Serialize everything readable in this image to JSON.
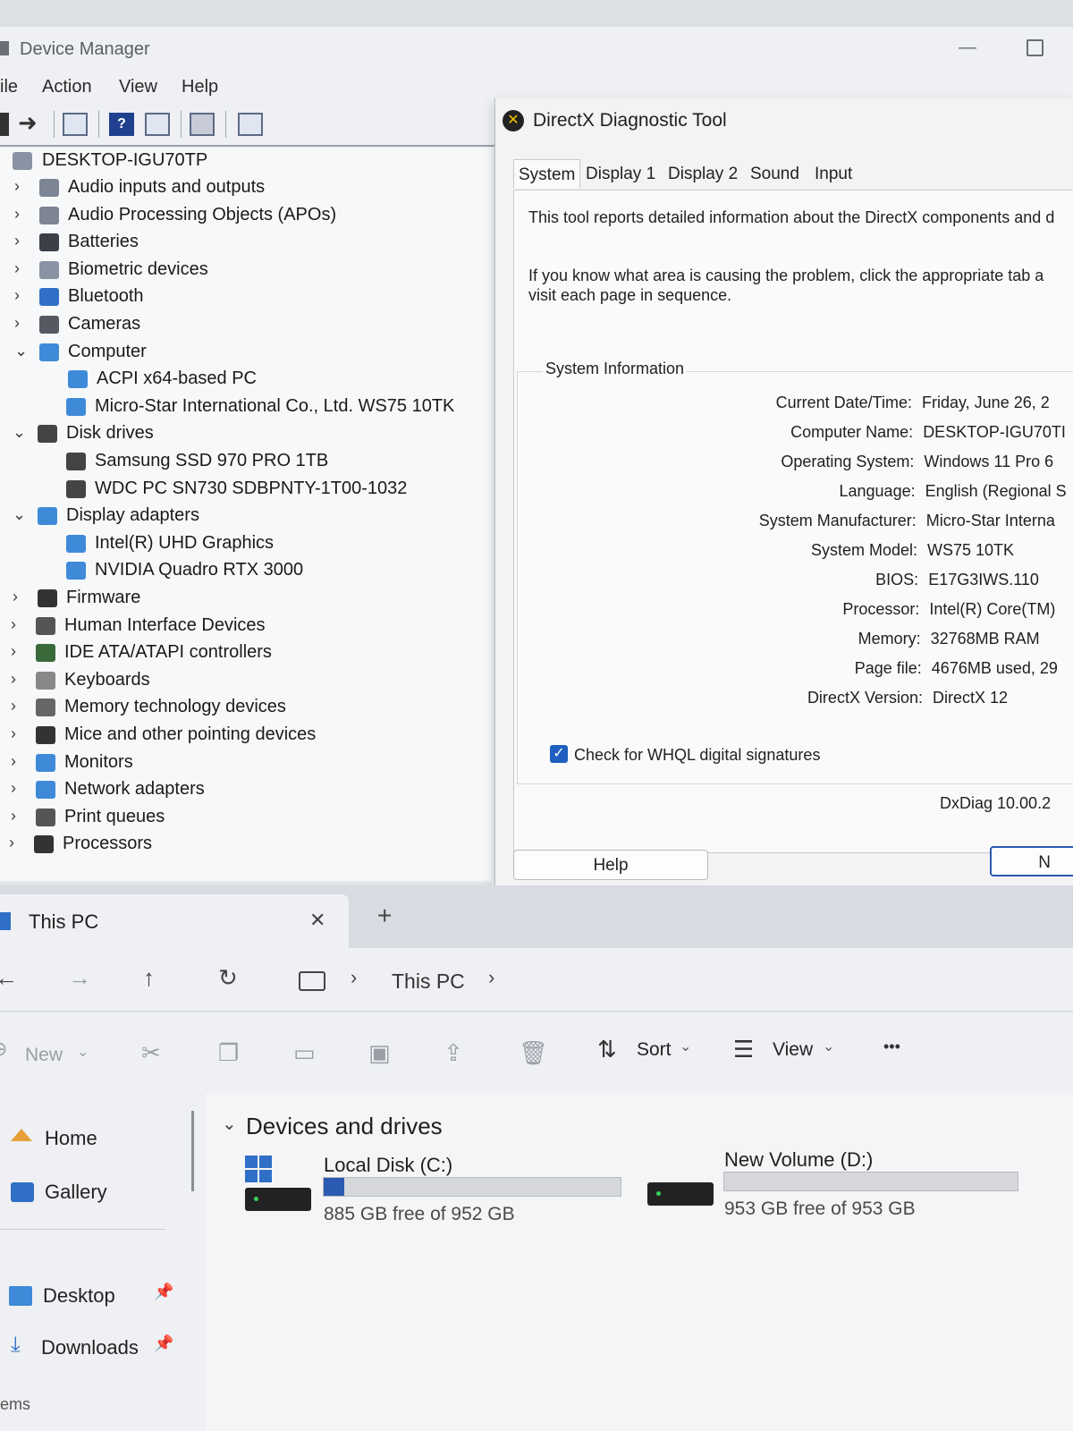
{
  "device_manager": {
    "title": "Device Manager",
    "menu": [
      "ile",
      "Action",
      "View",
      "Help"
    ],
    "computer_name": "DESKTOP-IGU70TP",
    "tree": [
      {
        "label": "Audio inputs and outputs",
        "expanded": false,
        "level": 1
      },
      {
        "label": "Audio Processing Objects (APOs)",
        "expanded": false,
        "level": 1
      },
      {
        "label": "Batteries",
        "expanded": false,
        "level": 1
      },
      {
        "label": "Biometric devices",
        "expanded": false,
        "level": 1
      },
      {
        "label": "Bluetooth",
        "expanded": false,
        "level": 1
      },
      {
        "label": "Cameras",
        "expanded": false,
        "level": 1
      },
      {
        "label": "Computer",
        "expanded": true,
        "level": 1
      },
      {
        "label": "ACPI x64-based PC",
        "level": 2
      },
      {
        "label": "Micro-Star International Co., Ltd. WS75 10TK",
        "level": 2
      },
      {
        "label": "Disk drives",
        "expanded": true,
        "level": 1
      },
      {
        "label": "Samsung SSD 970 PRO 1TB",
        "level": 2
      },
      {
        "label": "WDC PC SN730 SDBPNTY-1T00-1032",
        "level": 2
      },
      {
        "label": "Display adapters",
        "expanded": true,
        "level": 1
      },
      {
        "label": "Intel(R) UHD Graphics",
        "level": 2
      },
      {
        "label": "NVIDIA Quadro RTX 3000",
        "level": 2
      },
      {
        "label": "Firmware",
        "expanded": false,
        "level": 1
      },
      {
        "label": "Human Interface Devices",
        "expanded": false,
        "level": 1
      },
      {
        "label": "IDE ATA/ATAPI controllers",
        "expanded": false,
        "level": 1
      },
      {
        "label": "Keyboards",
        "expanded": false,
        "level": 1
      },
      {
        "label": "Memory technology devices",
        "expanded": false,
        "level": 1
      },
      {
        "label": "Mice and other pointing devices",
        "expanded": false,
        "level": 1
      },
      {
        "label": "Monitors",
        "expanded": false,
        "level": 1
      },
      {
        "label": "Network adapters",
        "expanded": false,
        "level": 1
      },
      {
        "label": "Print queues",
        "expanded": false,
        "level": 1
      },
      {
        "label": "Processors",
        "expanded": false,
        "level": 1
      }
    ]
  },
  "directx": {
    "title": "DirectX Diagnostic Tool",
    "tabs": [
      "System",
      "Display 1",
      "Display 2",
      "Sound",
      "Input"
    ],
    "intro1": "This tool reports detailed information about the DirectX components and d",
    "intro2": "If you know what area is causing the problem, click the appropriate tab a",
    "intro3": "visit each page in sequence.",
    "group_title": "System Information",
    "info": [
      {
        "label": "Current Date/Time:",
        "value": "Friday, June 26, 2"
      },
      {
        "label": "Computer Name:",
        "value": "DESKTOP-IGU70TI"
      },
      {
        "label": "Operating System:",
        "value": "Windows 11 Pro 6"
      },
      {
        "label": "Language:",
        "value": "English (Regional S"
      },
      {
        "label": "System Manufacturer:",
        "value": "Micro-Star Interna"
      },
      {
        "label": "System Model:",
        "value": "WS75 10TK"
      },
      {
        "label": "BIOS:",
        "value": "E17G3IWS.110"
      },
      {
        "label": "Processor:",
        "value": "Intel(R) Core(TM)"
      },
      {
        "label": "Memory:",
        "value": "32768MB RAM"
      },
      {
        "label": "Page file:",
        "value": "4676MB used, 29"
      },
      {
        "label": "DirectX Version:",
        "value": "DirectX 12"
      }
    ],
    "whql_label": "Check for WHQL digital signatures",
    "whql_checked": true,
    "version": "DxDiag 10.00.2",
    "help_button": "Help",
    "next_button": "N"
  },
  "explorer": {
    "tab_title": "This PC",
    "tab_close": "✕",
    "tab_add": "+",
    "breadcrumb": "This PC",
    "cmd_new": "New",
    "cmd_sort": "Sort",
    "cmd_view": "View",
    "cmd_more": "•••",
    "sidebar": [
      "Home",
      "Gallery",
      "Desktop",
      "Downloads"
    ],
    "sidebar_bottom_text": "ems",
    "section_title": "Devices and drives",
    "drives": [
      {
        "name": "Local Disk (C:)",
        "free_text": "885 GB free of 952 GB",
        "used_fraction": 0.07
      },
      {
        "name": "New Volume (D:)",
        "free_text": "953 GB free of 953 GB",
        "used_fraction": 0.0
      }
    ]
  },
  "colors": {
    "accent": "#2a5bb0",
    "checkbox": "#1f5fbf",
    "directx_logo": "#f4c400"
  }
}
